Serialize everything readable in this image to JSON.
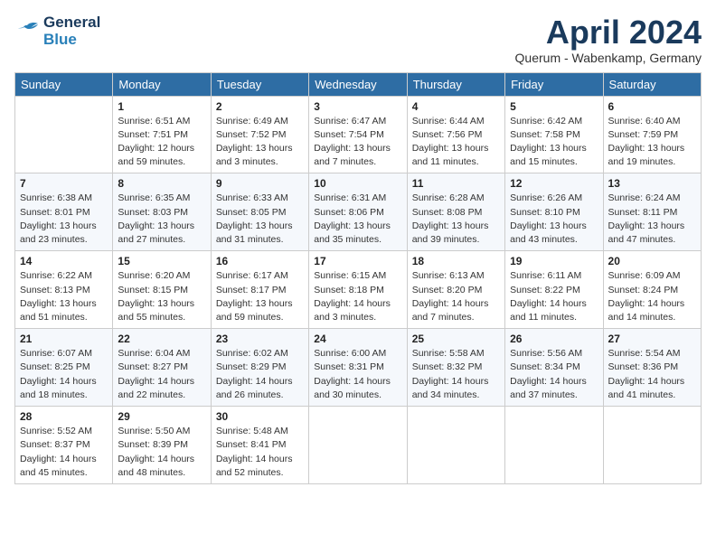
{
  "header": {
    "logo_line1": "General",
    "logo_line2": "Blue",
    "title": "April 2024",
    "location": "Querum -  Wabenkamp, Germany"
  },
  "weekdays": [
    "Sunday",
    "Monday",
    "Tuesday",
    "Wednesday",
    "Thursday",
    "Friday",
    "Saturday"
  ],
  "weeks": [
    [
      {
        "day": "",
        "sunrise": "",
        "sunset": "",
        "daylight": ""
      },
      {
        "day": "1",
        "sunrise": "Sunrise: 6:51 AM",
        "sunset": "Sunset: 7:51 PM",
        "daylight": "Daylight: 12 hours and 59 minutes."
      },
      {
        "day": "2",
        "sunrise": "Sunrise: 6:49 AM",
        "sunset": "Sunset: 7:52 PM",
        "daylight": "Daylight: 13 hours and 3 minutes."
      },
      {
        "day": "3",
        "sunrise": "Sunrise: 6:47 AM",
        "sunset": "Sunset: 7:54 PM",
        "daylight": "Daylight: 13 hours and 7 minutes."
      },
      {
        "day": "4",
        "sunrise": "Sunrise: 6:44 AM",
        "sunset": "Sunset: 7:56 PM",
        "daylight": "Daylight: 13 hours and 11 minutes."
      },
      {
        "day": "5",
        "sunrise": "Sunrise: 6:42 AM",
        "sunset": "Sunset: 7:58 PM",
        "daylight": "Daylight: 13 hours and 15 minutes."
      },
      {
        "day": "6",
        "sunrise": "Sunrise: 6:40 AM",
        "sunset": "Sunset: 7:59 PM",
        "daylight": "Daylight: 13 hours and 19 minutes."
      }
    ],
    [
      {
        "day": "7",
        "sunrise": "Sunrise: 6:38 AM",
        "sunset": "Sunset: 8:01 PM",
        "daylight": "Daylight: 13 hours and 23 minutes."
      },
      {
        "day": "8",
        "sunrise": "Sunrise: 6:35 AM",
        "sunset": "Sunset: 8:03 PM",
        "daylight": "Daylight: 13 hours and 27 minutes."
      },
      {
        "day": "9",
        "sunrise": "Sunrise: 6:33 AM",
        "sunset": "Sunset: 8:05 PM",
        "daylight": "Daylight: 13 hours and 31 minutes."
      },
      {
        "day": "10",
        "sunrise": "Sunrise: 6:31 AM",
        "sunset": "Sunset: 8:06 PM",
        "daylight": "Daylight: 13 hours and 35 minutes."
      },
      {
        "day": "11",
        "sunrise": "Sunrise: 6:28 AM",
        "sunset": "Sunset: 8:08 PM",
        "daylight": "Daylight: 13 hours and 39 minutes."
      },
      {
        "day": "12",
        "sunrise": "Sunrise: 6:26 AM",
        "sunset": "Sunset: 8:10 PM",
        "daylight": "Daylight: 13 hours and 43 minutes."
      },
      {
        "day": "13",
        "sunrise": "Sunrise: 6:24 AM",
        "sunset": "Sunset: 8:11 PM",
        "daylight": "Daylight: 13 hours and 47 minutes."
      }
    ],
    [
      {
        "day": "14",
        "sunrise": "Sunrise: 6:22 AM",
        "sunset": "Sunset: 8:13 PM",
        "daylight": "Daylight: 13 hours and 51 minutes."
      },
      {
        "day": "15",
        "sunrise": "Sunrise: 6:20 AM",
        "sunset": "Sunset: 8:15 PM",
        "daylight": "Daylight: 13 hours and 55 minutes."
      },
      {
        "day": "16",
        "sunrise": "Sunrise: 6:17 AM",
        "sunset": "Sunset: 8:17 PM",
        "daylight": "Daylight: 13 hours and 59 minutes."
      },
      {
        "day": "17",
        "sunrise": "Sunrise: 6:15 AM",
        "sunset": "Sunset: 8:18 PM",
        "daylight": "Daylight: 14 hours and 3 minutes."
      },
      {
        "day": "18",
        "sunrise": "Sunrise: 6:13 AM",
        "sunset": "Sunset: 8:20 PM",
        "daylight": "Daylight: 14 hours and 7 minutes."
      },
      {
        "day": "19",
        "sunrise": "Sunrise: 6:11 AM",
        "sunset": "Sunset: 8:22 PM",
        "daylight": "Daylight: 14 hours and 11 minutes."
      },
      {
        "day": "20",
        "sunrise": "Sunrise: 6:09 AM",
        "sunset": "Sunset: 8:24 PM",
        "daylight": "Daylight: 14 hours and 14 minutes."
      }
    ],
    [
      {
        "day": "21",
        "sunrise": "Sunrise: 6:07 AM",
        "sunset": "Sunset: 8:25 PM",
        "daylight": "Daylight: 14 hours and 18 minutes."
      },
      {
        "day": "22",
        "sunrise": "Sunrise: 6:04 AM",
        "sunset": "Sunset: 8:27 PM",
        "daylight": "Daylight: 14 hours and 22 minutes."
      },
      {
        "day": "23",
        "sunrise": "Sunrise: 6:02 AM",
        "sunset": "Sunset: 8:29 PM",
        "daylight": "Daylight: 14 hours and 26 minutes."
      },
      {
        "day": "24",
        "sunrise": "Sunrise: 6:00 AM",
        "sunset": "Sunset: 8:31 PM",
        "daylight": "Daylight: 14 hours and 30 minutes."
      },
      {
        "day": "25",
        "sunrise": "Sunrise: 5:58 AM",
        "sunset": "Sunset: 8:32 PM",
        "daylight": "Daylight: 14 hours and 34 minutes."
      },
      {
        "day": "26",
        "sunrise": "Sunrise: 5:56 AM",
        "sunset": "Sunset: 8:34 PM",
        "daylight": "Daylight: 14 hours and 37 minutes."
      },
      {
        "day": "27",
        "sunrise": "Sunrise: 5:54 AM",
        "sunset": "Sunset: 8:36 PM",
        "daylight": "Daylight: 14 hours and 41 minutes."
      }
    ],
    [
      {
        "day": "28",
        "sunrise": "Sunrise: 5:52 AM",
        "sunset": "Sunset: 8:37 PM",
        "daylight": "Daylight: 14 hours and 45 minutes."
      },
      {
        "day": "29",
        "sunrise": "Sunrise: 5:50 AM",
        "sunset": "Sunset: 8:39 PM",
        "daylight": "Daylight: 14 hours and 48 minutes."
      },
      {
        "day": "30",
        "sunrise": "Sunrise: 5:48 AM",
        "sunset": "Sunset: 8:41 PM",
        "daylight": "Daylight: 14 hours and 52 minutes."
      },
      {
        "day": "",
        "sunrise": "",
        "sunset": "",
        "daylight": ""
      },
      {
        "day": "",
        "sunrise": "",
        "sunset": "",
        "daylight": ""
      },
      {
        "day": "",
        "sunrise": "",
        "sunset": "",
        "daylight": ""
      },
      {
        "day": "",
        "sunrise": "",
        "sunset": "",
        "daylight": ""
      }
    ]
  ]
}
